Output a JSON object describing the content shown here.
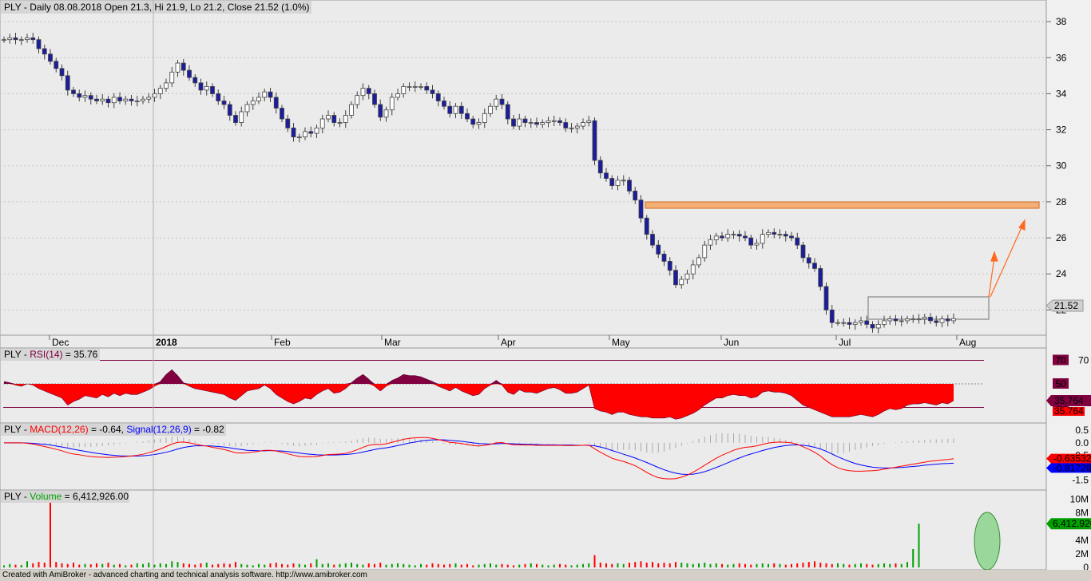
{
  "header": {
    "symbol_prefix": "PLY - ",
    "price_info": "Daily 08.08.2018 Open 21.3, Hi 21.9, Lo 21.2, Close 21.52 (1.0%)"
  },
  "footer": {
    "text": "Created with AmiBroker - advanced charting and technical analysis software. http://www.amibroker.com"
  },
  "colors": {
    "up_fill": "#ffffff",
    "down_fill": "#1c1c9e",
    "candle_outline": "#404040",
    "panel_bg": "#ebebeb",
    "resistance_box": "#f4a460",
    "arrow": "#ff6a20",
    "rsi_fill": "#ff0000",
    "rsi_over": "#800040",
    "macd_line": "#ff0000",
    "signal_line": "#0000ff",
    "volume_up": "#00a000",
    "volume_down": "#ff0000"
  },
  "chart_data": [
    {
      "type": "candlestick",
      "title": "PLY - Daily 08.08.2018 Open 21.3, Hi 21.9, Lo 21.2, Close 21.52 (1.0%)",
      "y_ticks": [
        "38",
        "36",
        "34",
        "32",
        "30",
        "28",
        "26",
        "24",
        "22"
      ],
      "x_ticks": [
        "Dec",
        "2018",
        "Feb",
        "Mar",
        "Apr",
        "May",
        "Jun",
        "Jul",
        "Aug"
      ],
      "last_close_label": "21.52",
      "ylim": [
        20.6,
        39.2
      ],
      "closes": [
        37.0,
        37.1,
        37.0,
        37.0,
        37.1,
        37.0,
        36.5,
        36.2,
        35.8,
        35.4,
        35.0,
        34.2,
        34.0,
        33.8,
        33.9,
        33.7,
        33.6,
        33.7,
        33.5,
        33.8,
        33.6,
        33.7,
        33.6,
        33.6,
        33.7,
        33.8,
        34.0,
        34.3,
        34.6,
        35.2,
        35.7,
        35.3,
        34.9,
        34.6,
        34.2,
        34.4,
        34.0,
        33.6,
        33.4,
        32.8,
        32.4,
        33.0,
        33.4,
        33.6,
        33.8,
        34.1,
        33.8,
        33.2,
        32.6,
        32.1,
        31.6,
        31.6,
        31.9,
        31.8,
        32.1,
        32.6,
        32.8,
        32.4,
        32.4,
        32.8,
        33.4,
        33.9,
        34.3,
        34.0,
        33.4,
        32.7,
        33.1,
        33.8,
        34.0,
        34.4,
        34.4,
        34.4,
        34.4,
        34.2,
        34.0,
        33.6,
        33.3,
        32.9,
        33.3,
        32.9,
        32.6,
        32.3,
        32.4,
        32.9,
        33.3,
        33.7,
        33.4,
        32.6,
        32.2,
        32.6,
        32.4,
        32.4,
        32.3,
        32.4,
        32.5,
        32.5,
        32.4,
        32.1,
        32.1,
        32.2,
        32.4,
        32.5,
        30.3,
        29.6,
        29.3,
        28.9,
        29.2,
        29.2,
        28.6,
        28.1,
        27.1,
        26.2,
        25.6,
        25.1,
        24.7,
        24.2,
        23.4,
        23.7,
        24.0,
        24.5,
        24.9,
        25.6,
        25.9,
        26.1,
        26.0,
        26.2,
        26.2,
        26.1,
        26.0,
        25.6,
        25.7,
        26.2,
        26.3,
        26.2,
        26.2,
        26.1,
        26.0,
        25.6,
        24.9,
        24.6,
        24.3,
        23.3,
        22.0,
        21.3,
        21.3,
        21.3,
        21.2,
        21.3,
        21.4,
        21.2,
        21.0,
        21.2,
        21.4,
        21.5,
        21.4,
        21.4,
        21.5,
        21.5,
        21.5,
        21.6,
        21.4,
        21.3,
        21.5,
        21.4,
        21.52
      ]
    },
    {
      "type": "area",
      "title": "PLY - RSI(14) = 35.76",
      "prefix": "PLY - ",
      "name": "RSI(14)",
      "value_text": " = 35.76",
      "levels": [
        70,
        50,
        30
      ],
      "level_labels": [
        "70",
        "50",
        "30"
      ],
      "tick_label": "70",
      "last_value": "35.764",
      "ylim": [
        20,
        80
      ],
      "values": [
        52,
        51,
        49,
        48,
        50,
        49,
        46,
        44,
        42,
        40,
        38,
        32,
        35,
        37,
        40,
        39,
        38,
        41,
        39,
        42,
        40,
        42,
        41,
        41,
        43,
        45,
        48,
        52,
        58,
        62,
        57,
        51,
        48,
        46,
        45,
        44,
        43,
        42,
        41,
        38,
        36,
        40,
        44,
        45,
        46,
        49,
        46,
        41,
        38,
        35,
        33,
        35,
        38,
        37,
        41,
        44,
        46,
        42,
        43,
        46,
        51,
        55,
        58,
        54,
        48,
        44,
        48,
        53,
        55,
        58,
        57,
        57,
        56,
        54,
        52,
        48,
        46,
        44,
        47,
        44,
        42,
        40,
        41,
        46,
        49,
        53,
        49,
        43,
        41,
        45,
        43,
        43,
        42,
        44,
        46,
        47,
        45,
        42,
        42,
        43,
        46,
        49,
        29,
        27,
        26,
        24,
        26,
        26,
        24,
        23,
        22,
        22,
        21,
        21,
        21,
        22,
        20,
        21,
        23,
        25,
        28,
        32,
        35,
        38,
        38,
        40,
        41,
        40,
        40,
        38,
        39,
        43,
        44,
        43,
        43,
        42,
        40,
        36,
        32,
        30,
        28,
        26,
        24,
        22,
        22,
        22,
        22,
        23,
        24,
        23,
        22,
        24,
        27,
        29,
        28,
        29,
        32,
        33,
        33,
        34,
        33,
        32,
        34,
        33,
        35.76
      ]
    },
    {
      "type": "line",
      "title": "PLY - MACD(12,26) = -0.64, Signal(12,26,9) = -0.82",
      "prefix": "PLY - ",
      "macd_name": "MACD(12,26)",
      "macd_value_text": " = -0.64, ",
      "signal_name": "Signal(12,26,9)",
      "signal_value_text": " = -0.82",
      "y_ticks": [
        "0.5",
        "0.0",
        "-0.5",
        "-1.5"
      ],
      "macd_last": "-0.63532",
      "signal_last": "-0.81728",
      "ylim": [
        -1.8,
        0.7
      ],
      "series": [
        {
          "name": "MACD(12,26)",
          "values": [
            0.0,
            0.0,
            0.0,
            0.0,
            -0.02,
            -0.05,
            -0.1,
            -0.15,
            -0.2,
            -0.26,
            -0.32,
            -0.4,
            -0.45,
            -0.48,
            -0.52,
            -0.55,
            -0.57,
            -0.58,
            -0.59,
            -0.58,
            -0.57,
            -0.55,
            -0.53,
            -0.5,
            -0.46,
            -0.4,
            -0.33,
            -0.25,
            -0.15,
            -0.05,
            0.02,
            0.03,
            0.0,
            -0.05,
            -0.1,
            -0.13,
            -0.18,
            -0.22,
            -0.27,
            -0.33,
            -0.4,
            -0.41,
            -0.4,
            -0.37,
            -0.34,
            -0.3,
            -0.3,
            -0.33,
            -0.38,
            -0.44,
            -0.5,
            -0.55,
            -0.56,
            -0.56,
            -0.55,
            -0.51,
            -0.47,
            -0.46,
            -0.45,
            -0.42,
            -0.36,
            -0.28,
            -0.18,
            -0.1,
            -0.06,
            -0.07,
            -0.04,
            0.02,
            0.08,
            0.14,
            0.18,
            0.2,
            0.21,
            0.21,
            0.18,
            0.13,
            0.08,
            0.02,
            0.0,
            -0.03,
            -0.07,
            -0.11,
            -0.13,
            -0.1,
            -0.06,
            0.0,
            0.01,
            -0.04,
            -0.08,
            -0.08,
            -0.09,
            -0.09,
            -0.1,
            -0.1,
            -0.1,
            -0.1,
            -0.1,
            -0.11,
            -0.11,
            -0.11,
            -0.1,
            -0.09,
            -0.24,
            -0.38,
            -0.5,
            -0.62,
            -0.69,
            -0.75,
            -0.83,
            -0.92,
            -1.05,
            -1.19,
            -1.31,
            -1.4,
            -1.44,
            -1.45,
            -1.44,
            -1.38,
            -1.3,
            -1.18,
            -1.05,
            -0.9,
            -0.76,
            -0.62,
            -0.5,
            -0.4,
            -0.3,
            -0.23,
            -0.18,
            -0.16,
            -0.12,
            -0.06,
            -0.01,
            0.02,
            0.03,
            0.02,
            0.0,
            -0.06,
            -0.16,
            -0.26,
            -0.38,
            -0.53,
            -0.72,
            -0.88,
            -1.0,
            -1.08,
            -1.12,
            -1.14,
            -1.14,
            -1.13,
            -1.12,
            -1.1,
            -1.06,
            -1.02,
            -0.98,
            -0.94,
            -0.9,
            -0.86,
            -0.82,
            -0.78,
            -0.74,
            -0.72,
            -0.69,
            -0.67,
            -0.64
          ]
        },
        {
          "name": "Signal(12,26,9)",
          "values": [
            0.0,
            0.0,
            0.0,
            0.0,
            -0.01,
            -0.02,
            -0.04,
            -0.06,
            -0.09,
            -0.13,
            -0.17,
            -0.21,
            -0.26,
            -0.3,
            -0.34,
            -0.38,
            -0.42,
            -0.45,
            -0.48,
            -0.5,
            -0.52,
            -0.53,
            -0.53,
            -0.53,
            -0.52,
            -0.5,
            -0.47,
            -0.43,
            -0.38,
            -0.32,
            -0.25,
            -0.19,
            -0.15,
            -0.12,
            -0.12,
            -0.12,
            -0.13,
            -0.15,
            -0.17,
            -0.2,
            -0.24,
            -0.27,
            -0.3,
            -0.31,
            -0.32,
            -0.32,
            -0.31,
            -0.32,
            -0.33,
            -0.35,
            -0.38,
            -0.41,
            -0.44,
            -0.46,
            -0.48,
            -0.49,
            -0.49,
            -0.49,
            -0.48,
            -0.47,
            -0.45,
            -0.42,
            -0.37,
            -0.32,
            -0.27,
            -0.23,
            -0.2,
            -0.16,
            -0.11,
            -0.06,
            -0.01,
            0.03,
            0.07,
            0.1,
            0.12,
            0.12,
            0.12,
            0.1,
            0.08,
            0.06,
            0.03,
            0.0,
            -0.03,
            -0.04,
            -0.05,
            -0.04,
            -0.03,
            -0.03,
            -0.04,
            -0.05,
            -0.06,
            -0.06,
            -0.07,
            -0.08,
            -0.08,
            -0.08,
            -0.09,
            -0.09,
            -0.09,
            -0.1,
            -0.1,
            -0.1,
            -0.12,
            -0.17,
            -0.23,
            -0.31,
            -0.38,
            -0.46,
            -0.53,
            -0.61,
            -0.7,
            -0.79,
            -0.89,
            -0.99,
            -1.08,
            -1.16,
            -1.22,
            -1.26,
            -1.27,
            -1.26,
            -1.22,
            -1.16,
            -1.08,
            -0.99,
            -0.9,
            -0.8,
            -0.7,
            -0.61,
            -0.52,
            -0.45,
            -0.38,
            -0.31,
            -0.25,
            -0.19,
            -0.15,
            -0.11,
            -0.09,
            -0.08,
            -0.1,
            -0.13,
            -0.18,
            -0.25,
            -0.34,
            -0.45,
            -0.56,
            -0.66,
            -0.75,
            -0.83,
            -0.89,
            -0.94,
            -0.98,
            -1.0,
            -1.01,
            -1.01,
            -1.0,
            -0.99,
            -0.97,
            -0.95,
            -0.93,
            -0.9,
            -0.88,
            -0.86,
            -0.84,
            -0.83,
            -0.82
          ]
        }
      ]
    },
    {
      "type": "bar",
      "title": "PLY - Volume = 6,412,926.00",
      "prefix": "PLY - ",
      "name": "Volume",
      "value_text": " = 6,412,926.00",
      "y_ticks": [
        "10M",
        "8M",
        "4M",
        "2M",
        "0"
      ],
      "last_value": "6,412,926",
      "ylim": [
        0,
        11000000
      ],
      "values": [
        300000,
        500000,
        400000,
        350000,
        900000,
        600000,
        800000,
        700000,
        9800000,
        800000,
        600000,
        500000,
        700000,
        400000,
        500000,
        450000,
        600000,
        500000,
        700000,
        400000,
        500000,
        300000,
        400000,
        600000,
        500000,
        700000,
        400000,
        600000,
        500000,
        900000,
        800000,
        600000,
        500000,
        400000,
        600000,
        700000,
        400000,
        500000,
        600000,
        500000,
        800000,
        500000,
        400000,
        300000,
        500000,
        400000,
        600000,
        700000,
        500000,
        400000,
        600000,
        500000,
        400000,
        600000,
        1200000,
        500000,
        600000,
        400000,
        500000,
        600000,
        700000,
        500000,
        400000,
        600000,
        500000,
        700000,
        400000,
        500000,
        600000,
        500000,
        400000,
        300000,
        500000,
        400000,
        600000,
        500000,
        400000,
        500000,
        600000,
        400000,
        500000,
        300000,
        400000,
        500000,
        600000,
        400000,
        500000,
        400000,
        300000,
        400000,
        500000,
        600000,
        500000,
        400000,
        300000,
        400000,
        500000,
        400000,
        300000,
        400000,
        500000,
        600000,
        1800000,
        700000,
        600000,
        500000,
        600000,
        500000,
        700000,
        800000,
        900000,
        700000,
        800000,
        600000,
        700000,
        600000,
        800000,
        700000,
        600000,
        500000,
        600000,
        700000,
        500000,
        600000,
        500000,
        400000,
        500000,
        600000,
        500000,
        400000,
        500000,
        600000,
        500000,
        600000,
        500000,
        400000,
        500000,
        600000,
        700000,
        800000,
        900000,
        700000,
        600000,
        500000,
        600000,
        500000,
        400000,
        500000,
        600000,
        500000,
        400000,
        500000,
        600000,
        500000,
        600000,
        500000,
        800000,
        2700000,
        6412926
      ]
    }
  ]
}
